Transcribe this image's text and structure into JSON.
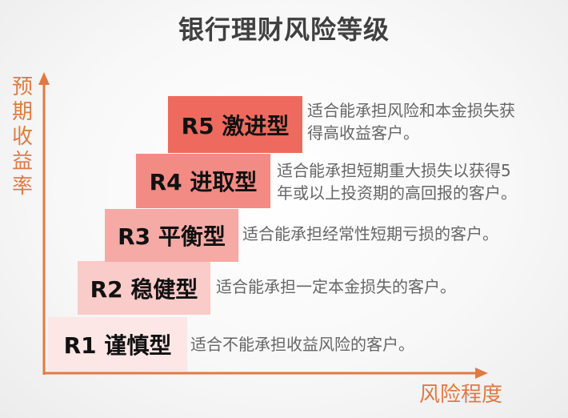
{
  "title": "银行理财风险等级",
  "y_axis_label": "预期收益率",
  "x_axis_label": "风险程度",
  "levels": [
    {
      "label": "R1 谨慎型",
      "desc_lines": [
        "适合不能承担收益风险的客户。"
      ],
      "color": "#fce6e6"
    },
    {
      "label": "R2 稳健型",
      "desc_lines": [
        "适合能承担一定本金损失的客户。"
      ],
      "color": "#f9cbc9"
    },
    {
      "label": "R3 平衡型",
      "desc_lines": [
        "适合能承担经常性短期亏损的客户。"
      ],
      "color": "#f5aaa5"
    },
    {
      "label": "R4 进取型",
      "desc_lines": [
        "适合能承担短期重大损失以获得5",
        "年或以上投资期的高回报的客户。"
      ],
      "color": "#f28b83"
    },
    {
      "label": "R5 激进型",
      "desc_lines": [
        "适合能承担风险和本金损失获",
        "得高收益客户。"
      ],
      "color": "#ee6a5e"
    }
  ],
  "colors": {
    "axis": "#e07a43",
    "title": "#404040",
    "description": "#666666"
  }
}
